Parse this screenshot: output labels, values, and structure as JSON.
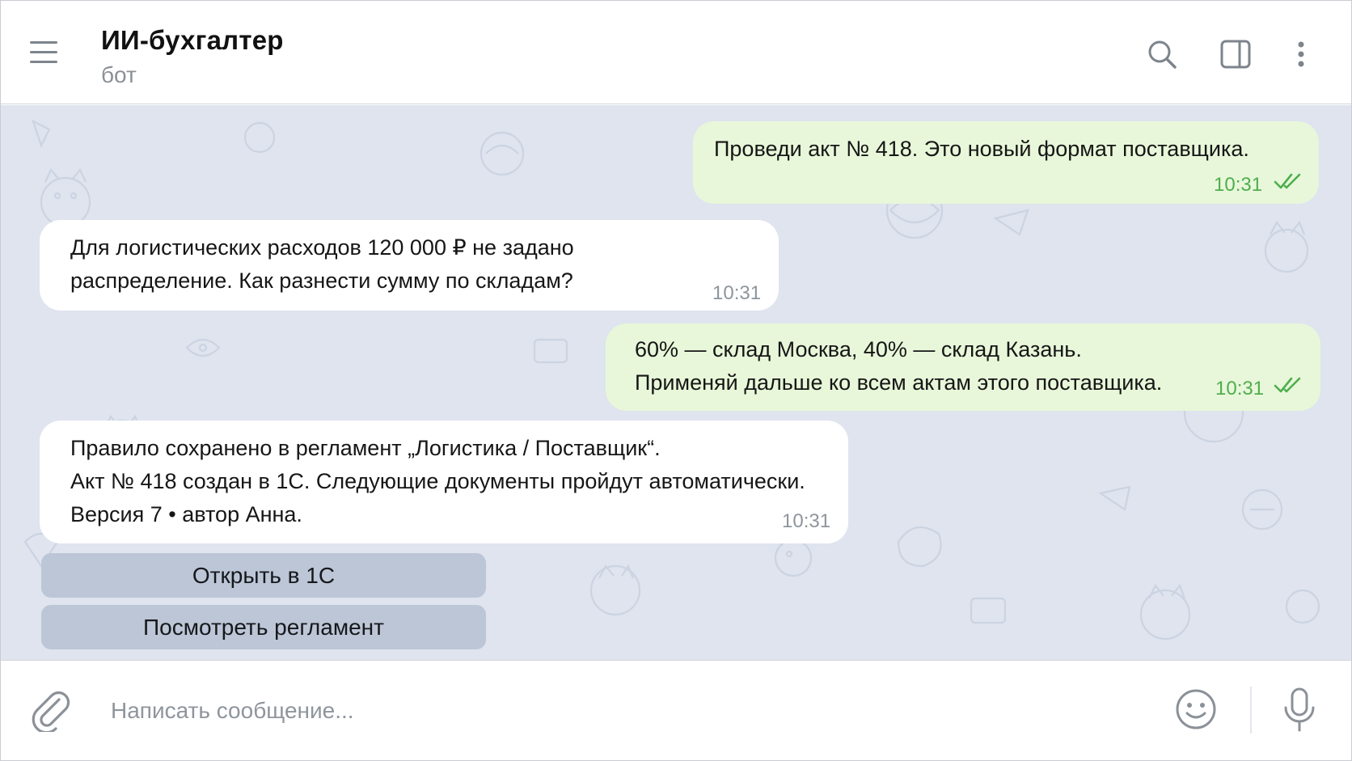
{
  "header": {
    "title": "ИИ-бухгалтер",
    "subtitle": "бот"
  },
  "messages": [
    {
      "direction": "outgoing",
      "lines": [
        "Проведи акт № 418. Это новый формат поставщика."
      ],
      "time": "10:31",
      "status": "read"
    },
    {
      "direction": "incoming",
      "lines": [
        "Для логистических расходов 120 000 ₽ не задано",
        "распределение. Как разнести сумму по складам?"
      ],
      "time": "10:31"
    },
    {
      "direction": "outgoing",
      "lines": [
        "60% — склад Москва, 40% — склад Казань.",
        "Применяй дальше ко всем актам этого поставщика."
      ],
      "time": "10:31",
      "status": "read"
    },
    {
      "direction": "incoming",
      "lines": [
        "Правило сохранено в регламент „Логистика / Поставщик“.",
        "Акт № 418 создан в 1С. Следующие документы пройдут автоматически.",
        "Версия 7 • автор Анна."
      ],
      "time": "10:31"
    }
  ],
  "keyboard": {
    "buttons": [
      "Открыть в 1С",
      "Посмотреть регламент"
    ]
  },
  "composer": {
    "placeholder": "Написать сообщение..."
  },
  "icons": {
    "menu": "hamburger-menu-icon",
    "search": "search-icon",
    "panel": "sidebar-panel-icon",
    "more": "more-vertical-icon",
    "attach": "paperclip-icon",
    "emoji": "smiley-icon",
    "mic": "microphone-icon",
    "read": "double-check-icon"
  },
  "colors": {
    "chat_background": "#dfe4ef",
    "outgoing_bubble": "#e8f7d9",
    "incoming_bubble": "#ffffff",
    "read_ticks": "#4fae4f",
    "keyboard_button": "#bcc6d6"
  }
}
